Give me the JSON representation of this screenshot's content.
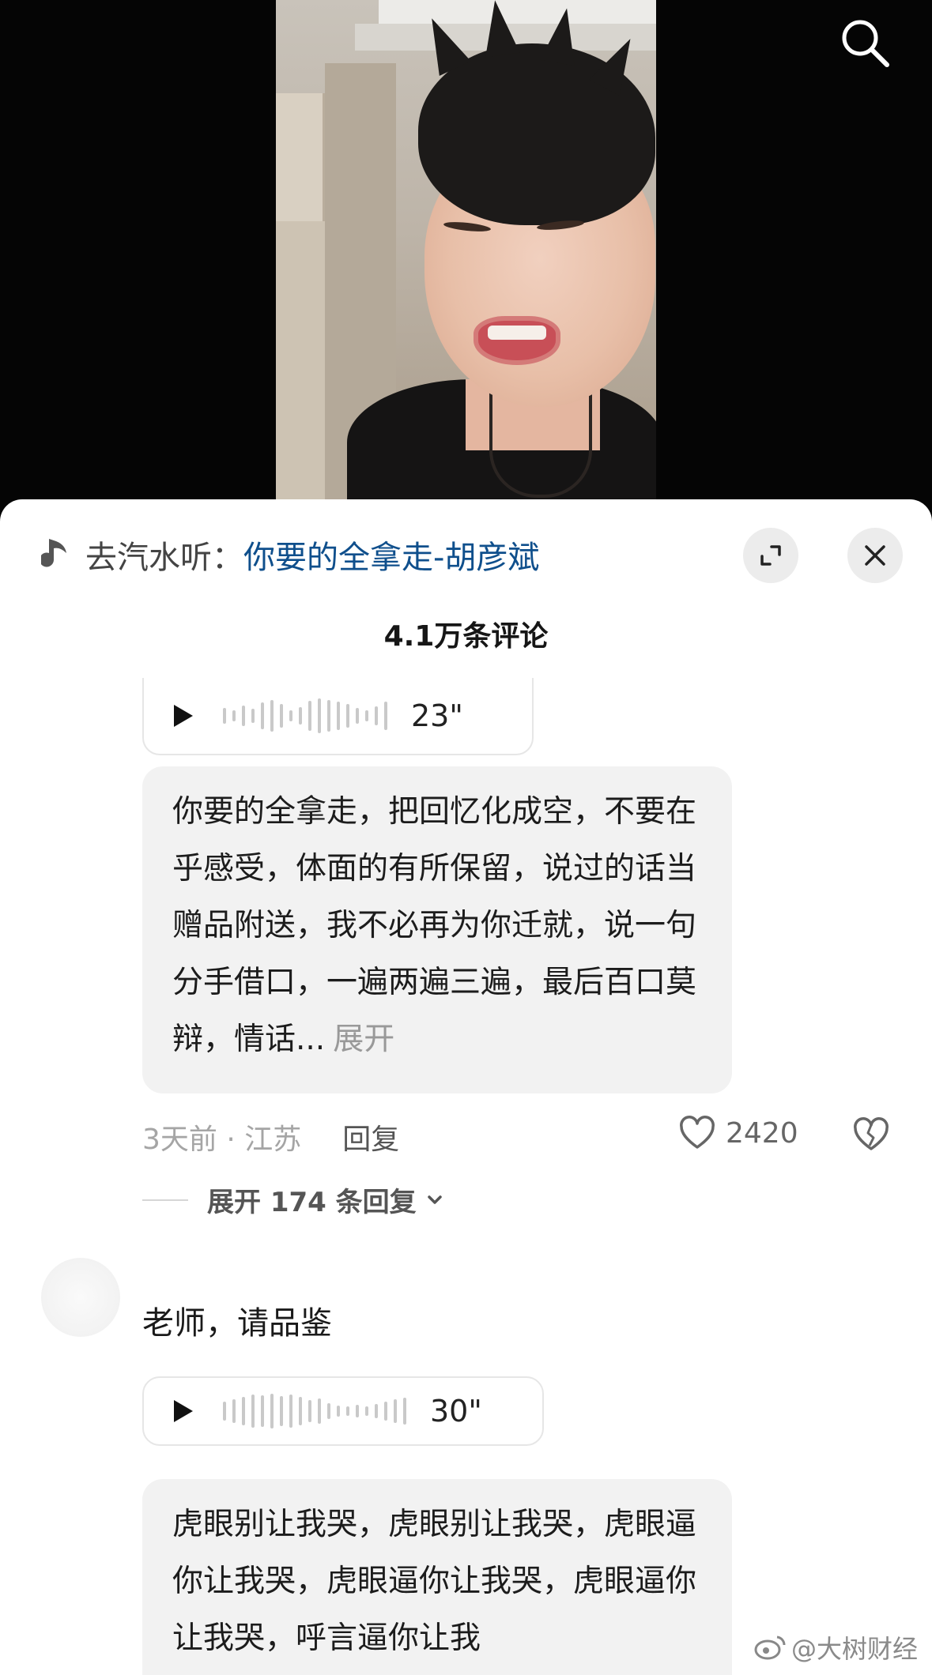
{
  "music": {
    "prefix": "去汽水听：",
    "song": "你要的全拿走-胡彦斌"
  },
  "header": {
    "comment_count": "4.1万条评论"
  },
  "comments": [
    {
      "voice_duration": "23\"",
      "text": "你要的全拿走，把回忆化成空，不要在乎感受，体面的有所保留，说过的话当赠品附送，我不必再为你迁就，说一句分手借口，一遍两遍三遍，最后百口莫辩，情话...",
      "expand_label": "展开",
      "time_location": "3天前 · 江苏",
      "reply_label": "回复",
      "likes": "2420",
      "replies_label": "展开 174 条回复"
    },
    {
      "text": "老师，请品鉴",
      "voice_duration": "30\"",
      "bubble_text": "虎眼别让我哭，虎眼别让我哭，虎眼逼你让我哭，虎眼逼你让我哭，虎眼逼你让我哭，呼言逼你让我"
    }
  ],
  "watermark": "@大树财经",
  "icons": {
    "search": "search-icon",
    "music": "music-note-icon",
    "expand": "expand-icon",
    "close": "close-icon",
    "play": "play-icon",
    "like": "heart-icon",
    "dislike": "broken-heart-icon",
    "chevron": "chevron-down-icon",
    "weibo": "weibo-icon"
  },
  "colors": {
    "link": "#0f4f8c",
    "muted": "#a5a5a5",
    "bubble_bg": "#f2f2f2"
  }
}
